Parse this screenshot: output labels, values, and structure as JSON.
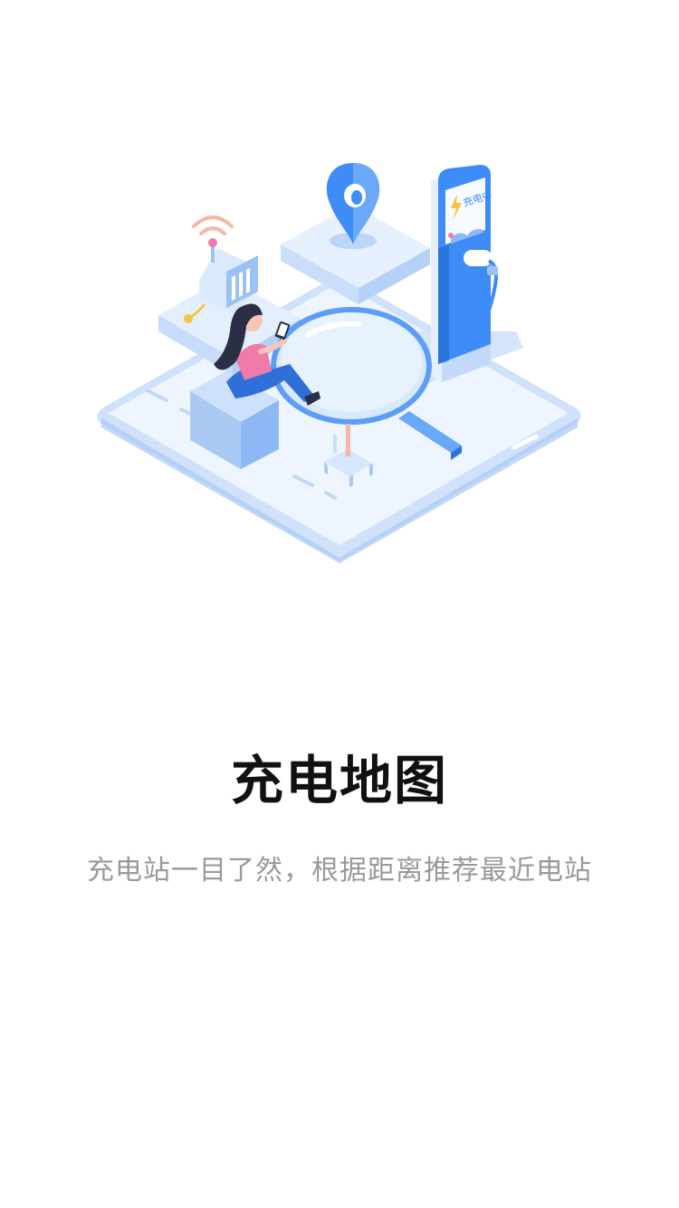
{
  "onboarding": {
    "title": "充电地图",
    "subtitle": "充电站一目了然，根据距离推荐最近电站"
  },
  "illustration": {
    "charger_screen_text": "充电中",
    "icons": [
      "map-pin-icon",
      "magnifier-icon",
      "wifi-signal-icon",
      "lightning-icon"
    ],
    "colors": {
      "primary_blue": "#3d8cf7",
      "light_blue": "#d8e8fd",
      "pale_blue": "#eef5fe",
      "shirt_pink": "#f07aa8",
      "hair": "#2a2f45",
      "accent_yellow": "#f5c542"
    }
  }
}
